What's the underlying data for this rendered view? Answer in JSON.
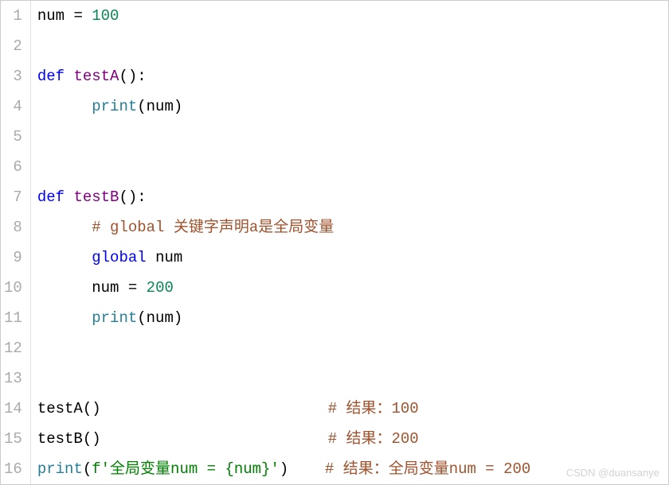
{
  "lineNumbers": [
    "1",
    "2",
    "3",
    "4",
    "5",
    "6",
    "7",
    "8",
    "9",
    "10",
    "11",
    "12",
    "13",
    "14",
    "15",
    "16"
  ],
  "code": {
    "l1": {
      "var": "num",
      "op": "=",
      "val": "100"
    },
    "l3": {
      "kw": "def",
      "name": "testA",
      "parens": "()",
      "colon": ":"
    },
    "l4": {
      "func": "print",
      "open": "(",
      "arg": "num",
      "close": ")"
    },
    "l7": {
      "kw": "def",
      "name": "testB",
      "parens": "()",
      "colon": ":"
    },
    "l8": {
      "comment": "# global 关键字声明a是全局变量"
    },
    "l9": {
      "kw": "global",
      "var": "num"
    },
    "l10": {
      "var": "num",
      "op": "=",
      "val": "200"
    },
    "l11": {
      "func": "print",
      "open": "(",
      "arg": "num",
      "close": ")"
    },
    "l14": {
      "call": "testA",
      "parens": "()",
      "comment": "# 结果：100"
    },
    "l15": {
      "call": "testB",
      "parens": "()",
      "comment": "# 结果：200"
    },
    "l16": {
      "func": "print",
      "open": "(",
      "prefix": "f",
      "str": "'全局变量num = {num}'",
      "close": ")",
      "comment": "# 结果：全局变量num = 200"
    }
  },
  "watermark": "CSDN @duansanye"
}
